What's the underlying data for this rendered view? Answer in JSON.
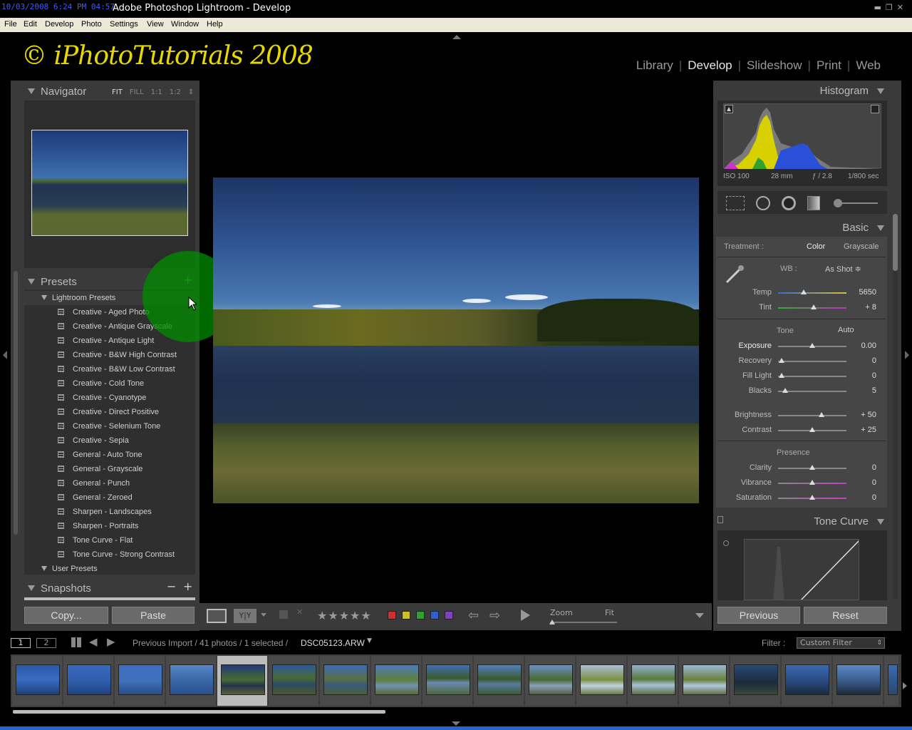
{
  "window": {
    "timestamp": "10/03/2008 6:24 PM 04:57",
    "title": "Adobe Photoshop Lightroom - Develop"
  },
  "menu": [
    "File",
    "Edit",
    "Develop",
    "Photo",
    "Settings",
    "View",
    "Window",
    "Help"
  ],
  "identity_plate": "© iPhotoTutorials 2008",
  "modules": {
    "library": "Library",
    "develop": "Develop",
    "slideshow": "Slideshow",
    "print": "Print",
    "web": "Web"
  },
  "navigator": {
    "title": "Navigator",
    "fit": "FIT",
    "fill": "FILL",
    "one_to_one": "1:1",
    "ratio": "1:2"
  },
  "presets": {
    "title": "Presets",
    "folder_lightroom": "Lightroom Presets",
    "folder_user": "User Presets",
    "items": [
      "Creative - Aged Photo",
      "Creative - Antique Grayscale",
      "Creative - Antique Light",
      "Creative - B&W High Contrast",
      "Creative - B&W Low Contrast",
      "Creative - Cold Tone",
      "Creative - Cyanotype",
      "Creative - Direct Positive",
      "Creative - Selenium Tone",
      "Creative - Sepia",
      "General - Auto Tone",
      "General - Grayscale",
      "General - Punch",
      "General - Zeroed",
      "Sharpen - Landscapes",
      "Sharpen - Portraits",
      "Tone Curve - Flat",
      "Tone Curve - Strong Contrast"
    ]
  },
  "snapshots": {
    "title": "Snapshots"
  },
  "left_buttons": {
    "copy": "Copy...",
    "paste": "Paste"
  },
  "toolbar": {
    "zoom_label": "Zoom",
    "zoom_value": "Fit",
    "stars": "★★★★★"
  },
  "label_colors": [
    "#d03030",
    "#d0c020",
    "#30a030",
    "#3060d0",
    "#8040c0"
  ],
  "histogram": {
    "title": "Histogram",
    "iso": "ISO 100",
    "focal": "28 mm",
    "aperture": "ƒ / 2.8",
    "shutter": "1/800 sec"
  },
  "basic": {
    "title": "Basic",
    "treatment_label": "Treatment :",
    "treatment_color": "Color",
    "treatment_grayscale": "Grayscale",
    "wb_label": "WB :",
    "wb_value": "As Shot ≑",
    "tone_label": "Tone",
    "auto_label": "Auto",
    "presence_label": "Presence",
    "sliders": {
      "temp": {
        "label": "Temp",
        "value": "5650",
        "pos": 0.38
      },
      "tint": {
        "label": "Tint",
        "value": "+ 8",
        "pos": 0.52
      },
      "exposure": {
        "label": "Exposure",
        "value": "0.00",
        "pos": 0.5
      },
      "recovery": {
        "label": "Recovery",
        "value": "0",
        "pos": 0.05
      },
      "fill_light": {
        "label": "Fill Light",
        "value": "0",
        "pos": 0.05
      },
      "blacks": {
        "label": "Blacks",
        "value": "5",
        "pos": 0.1
      },
      "brightness": {
        "label": "Brightness",
        "value": "+ 50",
        "pos": 0.64
      },
      "contrast": {
        "label": "Contrast",
        "value": "+ 25",
        "pos": 0.5
      },
      "clarity": {
        "label": "Clarity",
        "value": "0",
        "pos": 0.5
      },
      "vibrance": {
        "label": "Vibrance",
        "value": "0",
        "pos": 0.5
      },
      "saturation": {
        "label": "Saturation",
        "value": "0",
        "pos": 0.5
      }
    }
  },
  "tone_curve": {
    "title": "Tone Curve"
  },
  "right_buttons": {
    "previous": "Previous",
    "reset": "Reset"
  },
  "filmstrip": {
    "monitor1": "1",
    "monitor2": "2",
    "source": "Previous Import / 41 photos / 1 selected /",
    "filename": "DSC05123.ARW",
    "filter_label": "Filter :",
    "filter_value": "Custom Filter"
  }
}
